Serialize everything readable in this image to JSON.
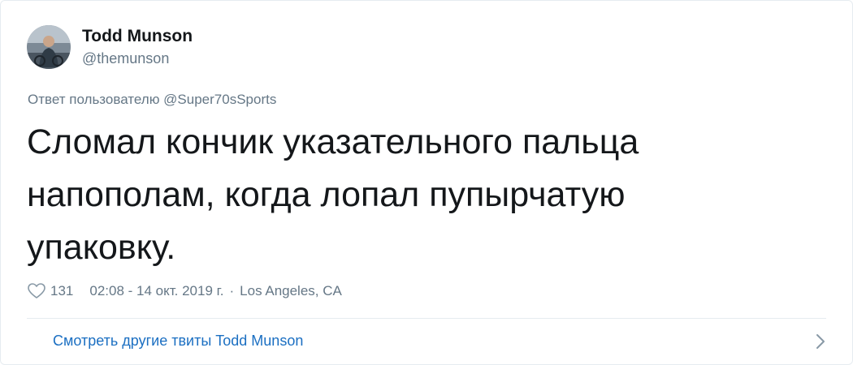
{
  "tweet": {
    "author": {
      "display_name": "Todd Munson",
      "handle": "@themunson"
    },
    "reply_to": "Ответ пользователю @Super70sSports",
    "text": "Сломал кончик указательного пальца напополам, когда лопал пупырчатую упаковку.",
    "likes": "131",
    "timestamp": "02:08 - 14 окт. 2019 г.",
    "separator": "·",
    "location": "Los Angeles, CA",
    "more_tweets_link": "Смотреть другие твиты Todd Munson"
  },
  "icons": {
    "like": "heart-icon",
    "chevron": "chevron-right-icon"
  },
  "colors": {
    "link": "#1b6fc2",
    "secondary_text": "#657786",
    "primary_text": "#14171a",
    "border": "#e6ecf0"
  }
}
